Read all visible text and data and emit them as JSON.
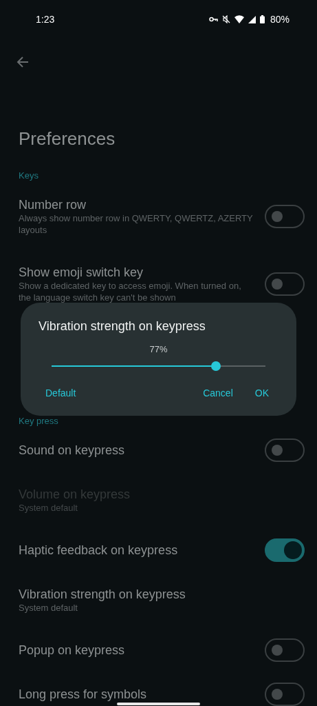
{
  "status_bar": {
    "time": "1:23",
    "battery": "80%"
  },
  "title": "Preferences",
  "sections": [
    {
      "header": "Keys",
      "items": [
        {
          "title": "Number row",
          "subtitle": "Always show number row in QWERTY, QWERTZ, AZERTY layouts",
          "kind": "switch",
          "on": false,
          "disabled": false
        },
        {
          "title": "Show emoji switch key",
          "subtitle": "Show a dedicated key to access emoji. When turned on, the language switch key can't be shown",
          "kind": "switch",
          "on": false,
          "disabled": false
        }
      ]
    },
    {
      "header": "Key press",
      "items": [
        {
          "title": "Sound on keypress",
          "kind": "switch",
          "on": false,
          "disabled": false
        },
        {
          "title": "Volume on keypress",
          "subtitle": "System default",
          "kind": "value",
          "disabled": true
        },
        {
          "title": "Haptic feedback on keypress",
          "kind": "switch",
          "on": true,
          "disabled": false
        },
        {
          "title": "Vibration strength on keypress",
          "subtitle": "System default",
          "kind": "value",
          "disabled": false
        },
        {
          "title": "Popup on keypress",
          "kind": "switch",
          "on": false,
          "disabled": false
        },
        {
          "title": "Long press for symbols",
          "kind": "switch",
          "on": false,
          "disabled": false
        }
      ]
    }
  ],
  "dialog": {
    "title": "Vibration strength on keypress",
    "value_text": "77%",
    "level": 0.77,
    "buttons": [
      {
        "label": "Default"
      },
      {
        "label": "Cancel"
      },
      {
        "label": "OK"
      }
    ]
  }
}
